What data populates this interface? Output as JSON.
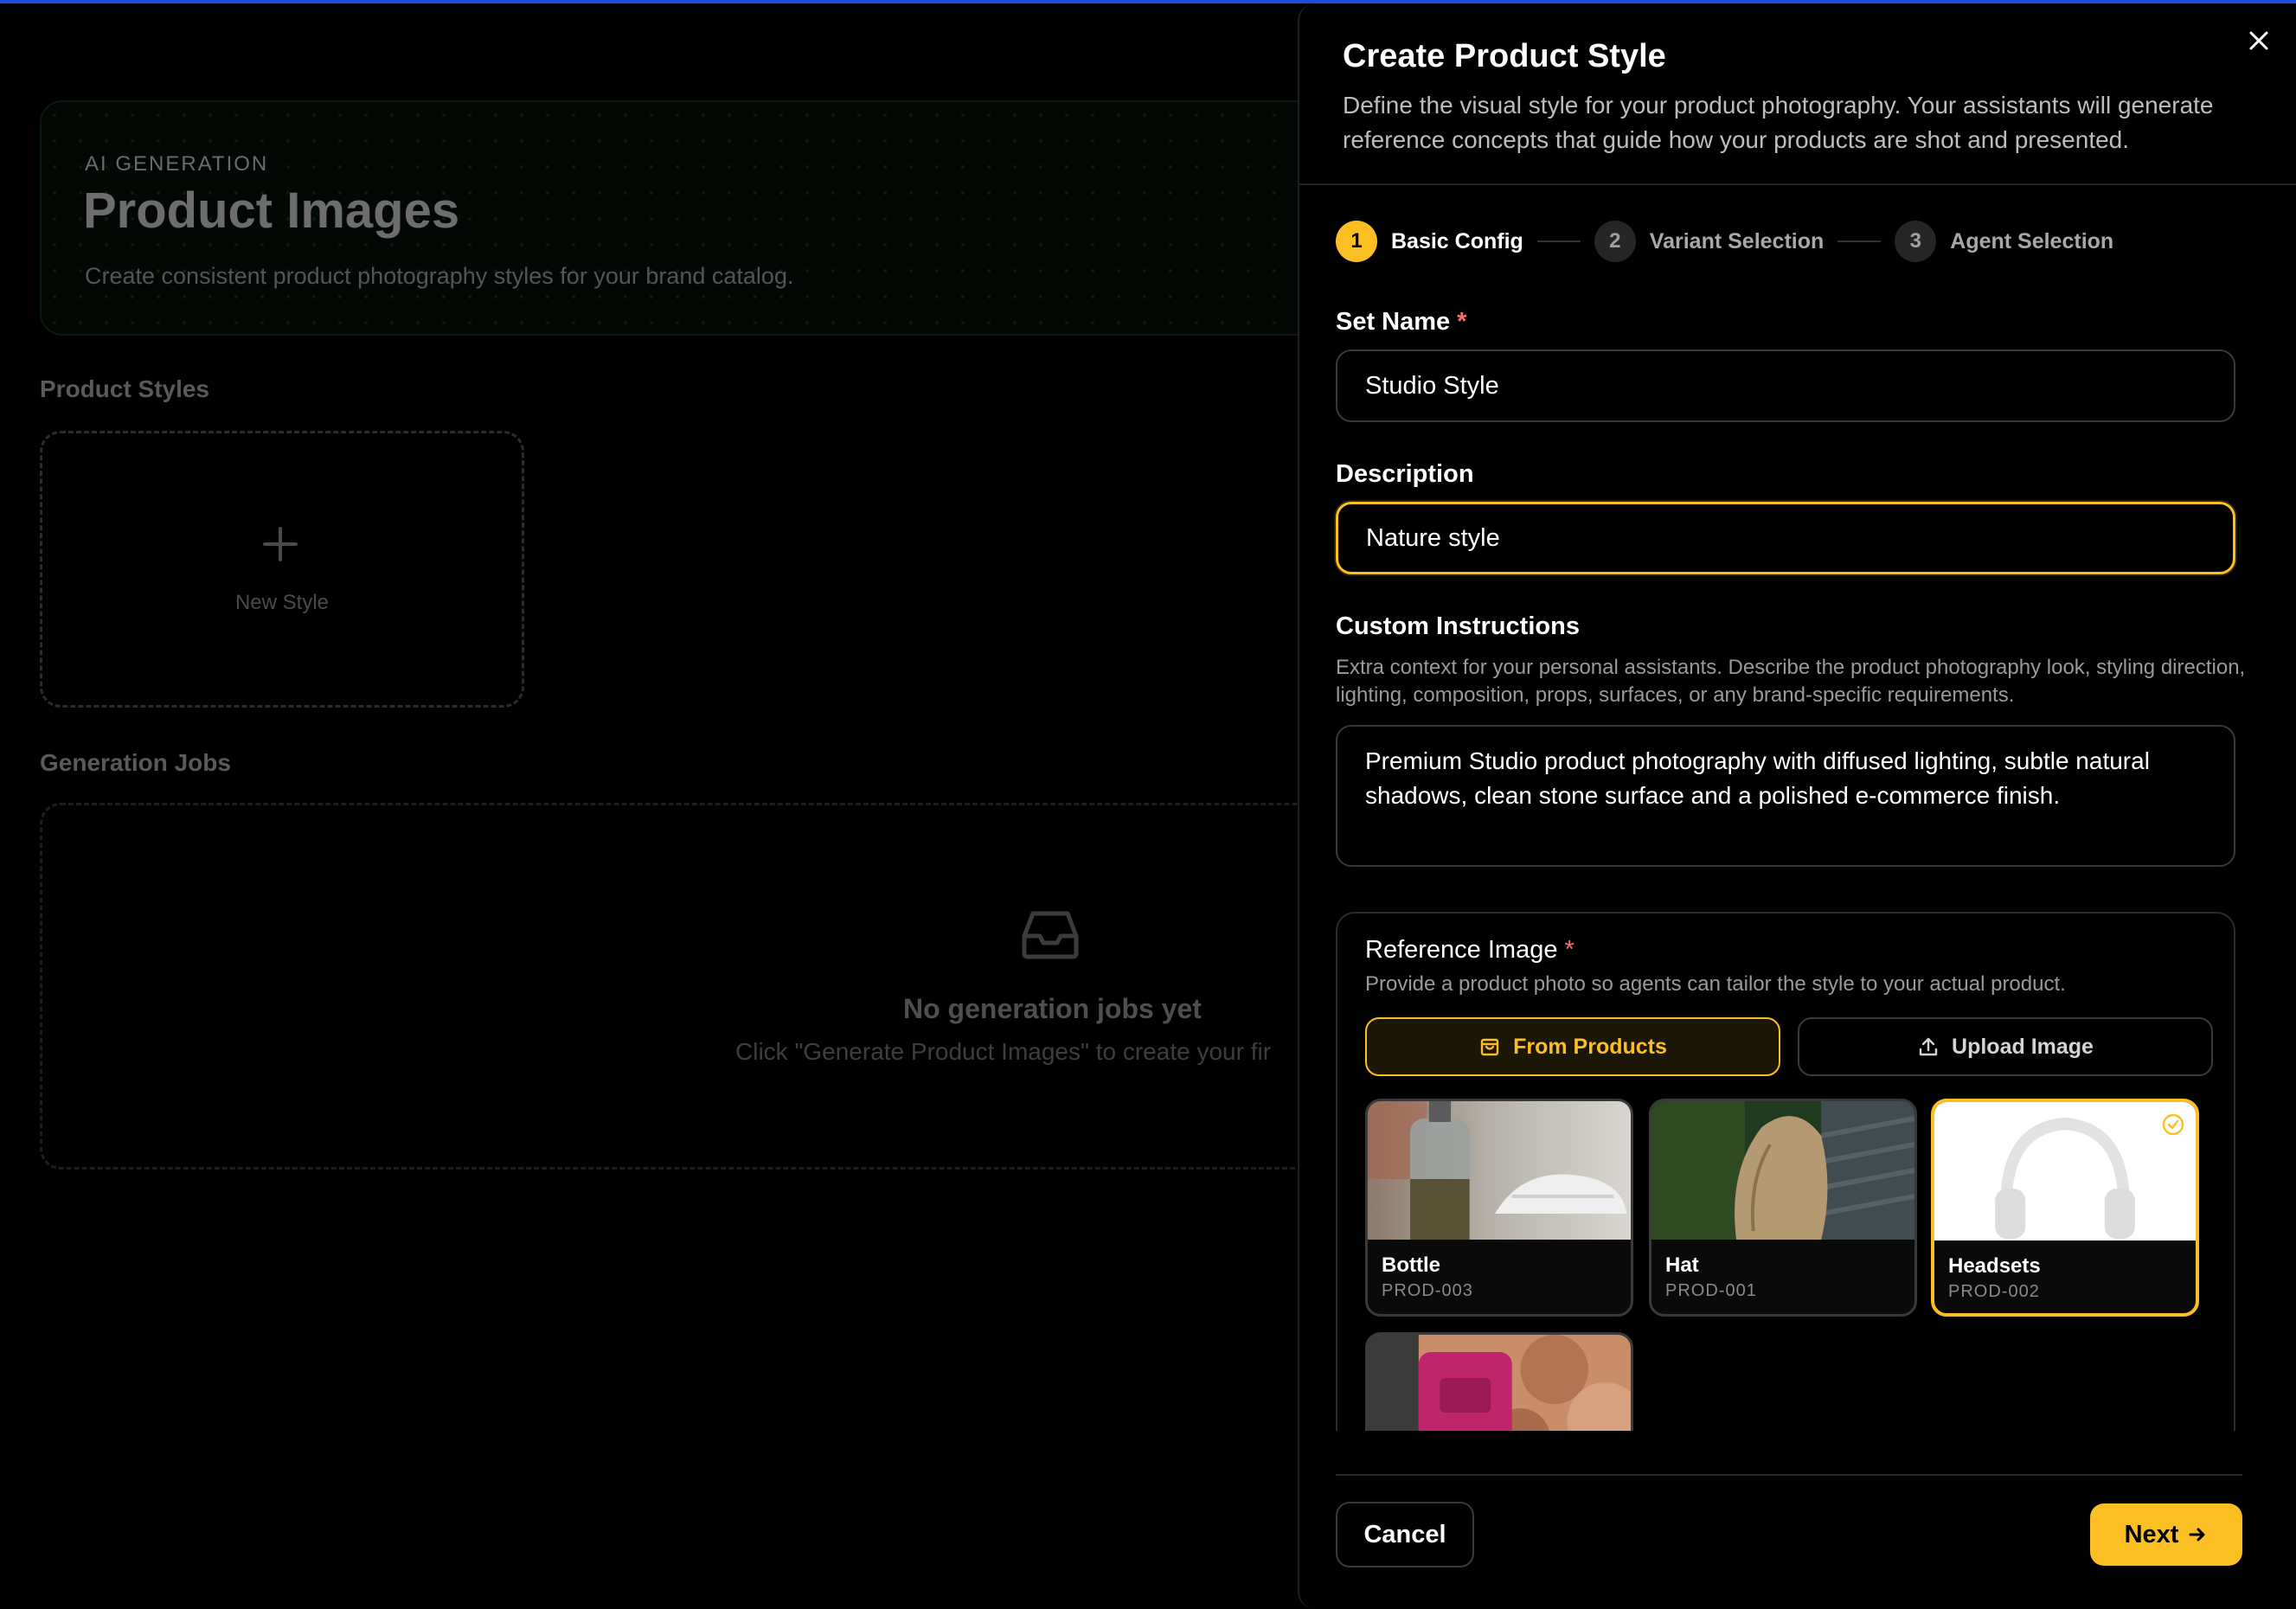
{
  "page": {
    "eyebrow": "AI GENERATION",
    "title": "Product Images",
    "subtitle": "Create consistent product photography styles for your brand catalog.",
    "product_styles_label": "Product Styles",
    "new_style_label": "New Style",
    "generation_jobs_label": "Generation Jobs",
    "jobs_empty_title": "No generation jobs yet",
    "jobs_empty_subtitle": "Click \"Generate Product Images\" to create your fir"
  },
  "drawer": {
    "title": "Create Product Style",
    "description": "Define the visual style for your product photography. Your assistants will generate reference concepts that guide how your products are shot and presented.",
    "steps": [
      {
        "number": "1",
        "label": "Basic Config",
        "active": true
      },
      {
        "number": "2",
        "label": "Variant Selection",
        "active": false
      },
      {
        "number": "3",
        "label": "Agent Selection",
        "active": false
      }
    ],
    "set_name": {
      "label": "Set Name",
      "required_mark": "*",
      "value": "Studio Style"
    },
    "description_field": {
      "label": "Description",
      "value": "Nature style"
    },
    "custom_instructions": {
      "label": "Custom Instructions",
      "help": "Extra context for your personal assistants. Describe the product photography look, styling direction, lighting, composition, props, surfaces, or any brand-specific requirements.",
      "value": "Premium Studio product photography with diffused lighting, subtle natural shadows, clean stone surface and a polished e-commerce finish."
    },
    "reference_image": {
      "label": "Reference Image",
      "required_mark": "*",
      "help": "Provide a product photo so agents can tailor the style to your actual product.",
      "tabs": [
        {
          "label": "From Products",
          "icon": "shopping-bag-icon",
          "active": true
        },
        {
          "label": "Upload Image",
          "icon": "upload-icon",
          "active": false
        }
      ],
      "products": [
        {
          "name": "Bottle",
          "sku": "PROD-003",
          "selected": false
        },
        {
          "name": "Hat",
          "sku": "PROD-001",
          "selected": false
        },
        {
          "name": "Headsets",
          "sku": "PROD-002",
          "selected": true
        },
        {
          "name": "",
          "sku": "",
          "selected": false
        }
      ]
    },
    "cancel_label": "Cancel",
    "next_label": "Next",
    "accent_color": "#fbbf24"
  }
}
